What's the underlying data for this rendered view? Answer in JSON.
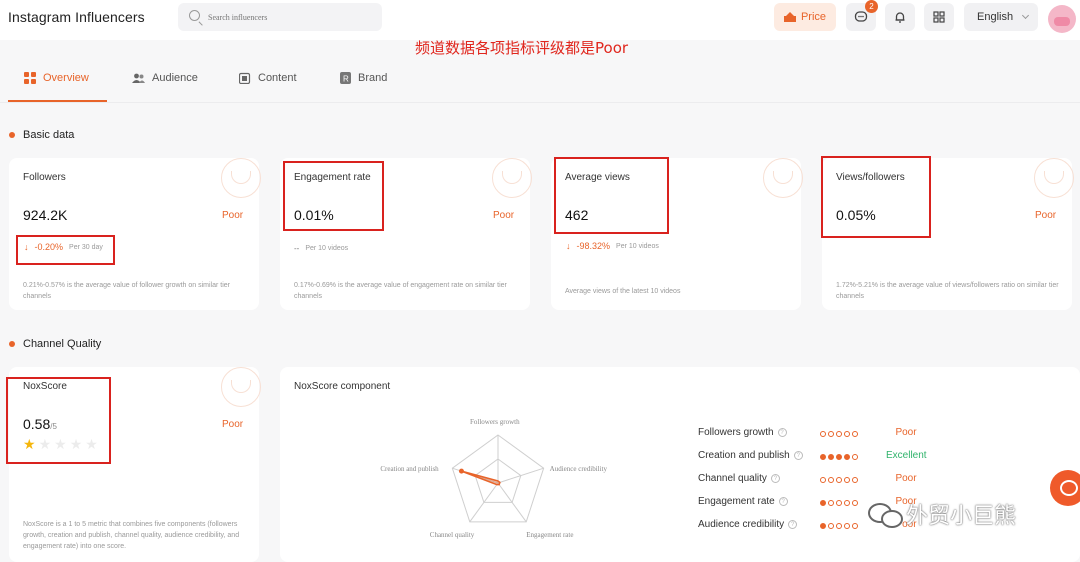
{
  "header": {
    "title": "Instagram Influencers",
    "search_placeholder": "Search influencers",
    "price_label": "Price",
    "message_badge": "2",
    "language": "English",
    "accent": "#e8642a"
  },
  "annotation": "频道数据各项指标评级都是Poor",
  "tabs": [
    {
      "label": "Overview",
      "icon": "overview-grid-icon",
      "active": true
    },
    {
      "label": "Audience",
      "icon": "users-icon",
      "active": false
    },
    {
      "label": "Content",
      "icon": "content-icon",
      "active": false
    },
    {
      "label": "Brand",
      "icon": "brand-icon",
      "active": false
    }
  ],
  "basic": {
    "section_title": "Basic data",
    "cards": [
      {
        "label": "Followers",
        "value": "924.2K",
        "rating": "Poor",
        "change": "-0.20%",
        "change_sub": "Per 30 day",
        "note": "0.21%-0.57% is the average value of follower growth on similar tier channels"
      },
      {
        "label": "Engagement rate",
        "value": "0.01%",
        "rating": "Poor",
        "change": "--",
        "change_sub": "Per 10 videos",
        "note": "0.17%-0.69% is the average value of engagement rate on similar tier channels"
      },
      {
        "label": "Average views",
        "value": "462",
        "rating": "",
        "change": "-98.32%",
        "change_sub": "Per 10 videos",
        "note": "Average views of the latest 10 videos"
      },
      {
        "label": "Views/followers",
        "value": "0.05%",
        "rating": "Poor",
        "change": "",
        "change_sub": "",
        "note": "1.72%-5.21% is the average value of views/followers ratio on similar tier channels"
      }
    ]
  },
  "quality": {
    "section_title": "Channel Quality",
    "noxscore": {
      "label": "NoxScore",
      "value": "0.58",
      "suffix": "/5",
      "rating": "Poor",
      "stars_filled": 1,
      "stars_total": 5,
      "note": "NoxScore is a 1 to 5 metric that combines five components (followers growth, creation and publish, channel quality, audience credibility, and engagement rate) into one score."
    },
    "component_title": "NoxScore component",
    "radar_labels": [
      "Followers growth",
      "Audience credibility",
      "Engagement rate",
      "Channel quality",
      "Creation and publish"
    ],
    "radar_values": [
      0,
      0,
      0,
      0,
      4
    ],
    "components": [
      {
        "label": "Followers growth",
        "dots": 0,
        "rating": "Poor"
      },
      {
        "label": "Creation and publish",
        "dots": 4,
        "rating": "Excellent"
      },
      {
        "label": "Channel quality",
        "dots": 0,
        "rating": "Poor"
      },
      {
        "label": "Engagement rate",
        "dots": 1,
        "rating": "Poor"
      },
      {
        "label": "Audience credibility",
        "dots": 1,
        "rating": "Poor"
      }
    ]
  },
  "brand_watermark": "外贸小巨熊"
}
